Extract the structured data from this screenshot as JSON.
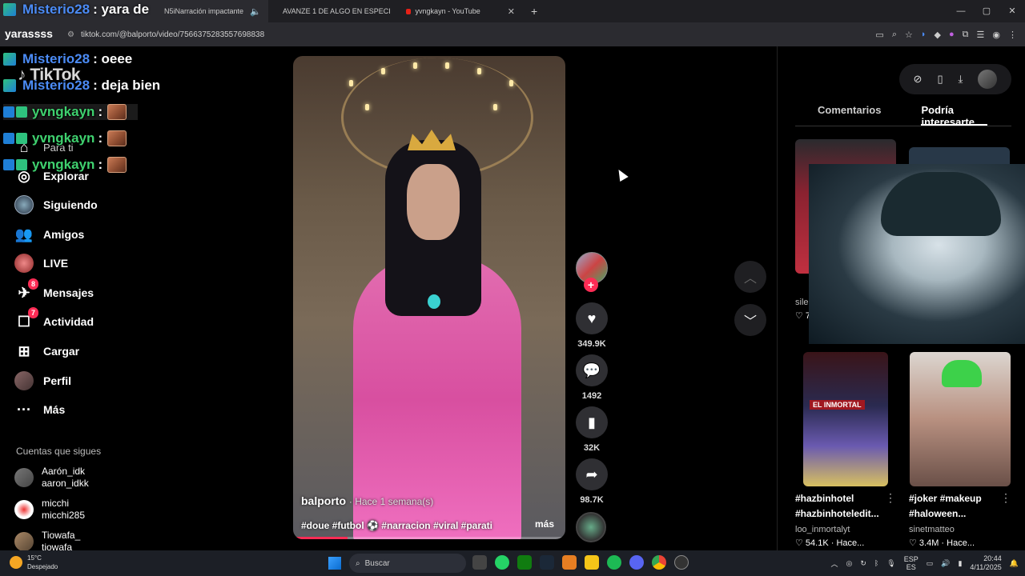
{
  "browser": {
    "tabs": [
      {
        "label": "N5iNarración impactante"
      },
      {
        "label": "AVANZE 1 DE ALGO EN ESPECI"
      },
      {
        "label": "yvngkayn - YouTube"
      }
    ],
    "new_tab": "+",
    "url": "tiktok.com/@balporto/video/7566375283557698838",
    "window_controls": [
      "—",
      "▢",
      "✕"
    ]
  },
  "stream_overlay": {
    "title_user": "Misterio28",
    "title_msg": ": yara de",
    "channel": "yarassss",
    "chat": [
      {
        "user": "Misterio28",
        "message": ": oeee",
        "color": "#4b8bf5"
      },
      {
        "user": "Misterio28",
        "message": ": deja bien",
        "color": "#4b8bf5"
      },
      {
        "user": "yvngkayn",
        "message": ":",
        "color": "#3fd16f"
      },
      {
        "user": "yvngkayn",
        "message": ":",
        "color": "#3fd16f"
      },
      {
        "user": "yvngkayn",
        "message": ":",
        "color": "#3fd16f"
      }
    ]
  },
  "tiktok": {
    "logo": "TikTok",
    "nav": [
      {
        "label": "Para ti",
        "icon": "home-icon"
      },
      {
        "label": "Explorar",
        "icon": "compass-icon"
      },
      {
        "label": "Siguiendo",
        "icon": "following-icon"
      },
      {
        "label": "Amigos",
        "icon": "friends-icon"
      },
      {
        "label": "LIVE",
        "icon": "live-icon"
      },
      {
        "label": "Mensajes",
        "icon": "messages-icon",
        "badge": "8"
      },
      {
        "label": "Actividad",
        "icon": "activity-icon",
        "badge": "7"
      },
      {
        "label": "Cargar",
        "icon": "upload-icon"
      },
      {
        "label": "Perfil",
        "icon": "profile-icon"
      },
      {
        "label": "Más",
        "icon": "more-icon"
      }
    ],
    "following_title": "Cuentas que sigues",
    "following": [
      {
        "name": "Aarón_idk",
        "handle": "aaron_idkk"
      },
      {
        "name": "micchi",
        "handle": "micchi285"
      },
      {
        "name": "Tiowafa_",
        "handle": "tiowafa"
      }
    ],
    "video": {
      "author": "balporto",
      "when": "· Hace 1 semana(s)",
      "tags": "#doue #futbol ⚽ #narracion #viral #parati",
      "more": "más",
      "progress": 0.2
    },
    "actions": {
      "likes": "349.9K",
      "comments": "1492",
      "saves": "32K",
      "shares": "98.7K"
    },
    "right_tabs": [
      "Comentarios",
      "Podría interesarte"
    ],
    "cards": [
      {
        "title": "",
        "user": "sile",
        "views": "♡ 7"
      },
      {
        "title": "",
        "user": "",
        "views": ""
      },
      {
        "title": "#hazbinhotel #hazbinhoteledit...",
        "user": "loo_inmortalyt",
        "views": "♡ 54.1K · Hace..."
      },
      {
        "title": "#joker #makeup #haloween...",
        "user": "sinetmatteo",
        "views": "♡ 3.4M · Hace..."
      }
    ],
    "card_badge": "EL INMORTAL"
  },
  "taskbar": {
    "weather_temp": "15°C",
    "weather_desc": "Despejado",
    "search": "Buscar",
    "lang_top": "ESP",
    "lang_bottom": "ES",
    "time": "20:44",
    "date": "4/11/2025"
  }
}
